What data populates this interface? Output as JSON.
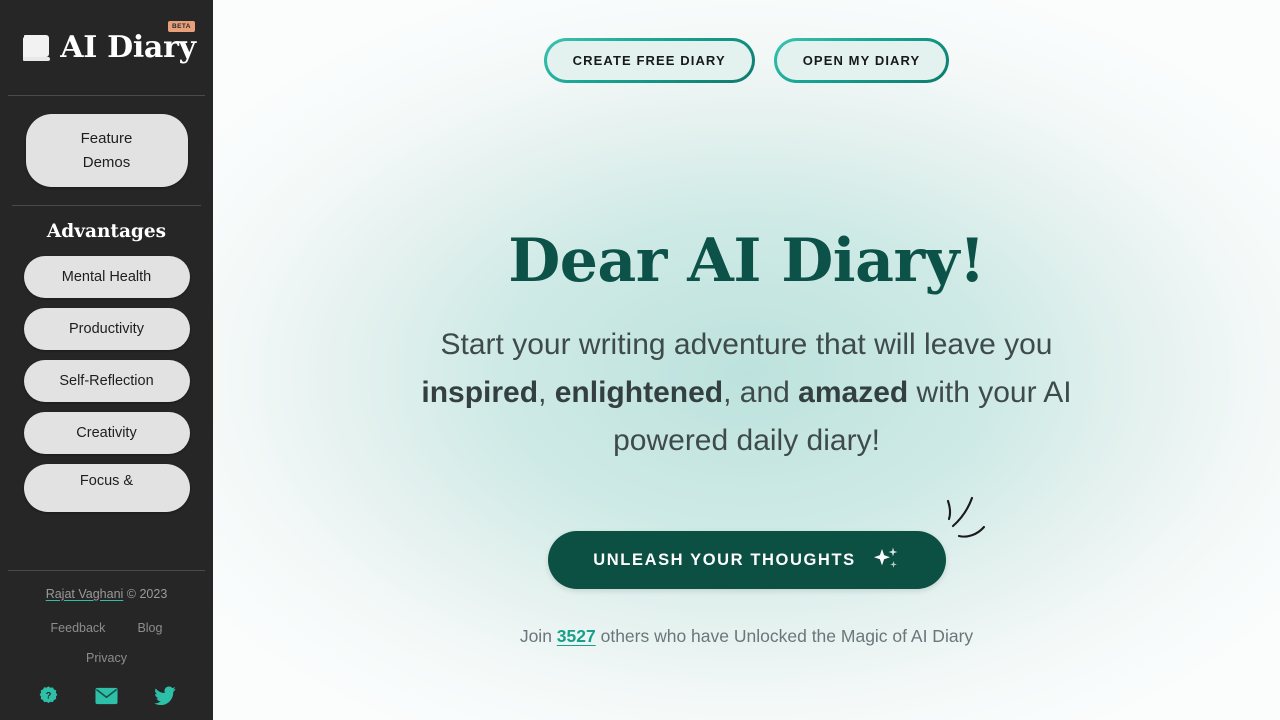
{
  "sidebar": {
    "brand": {
      "name": "AI Diary",
      "badge": "BETA",
      "icon": "book-icon"
    },
    "feature_demos_label": "Feature\nDemos",
    "feature_demos_line1": "Feature",
    "feature_demos_line2": "Demos",
    "section_title": "Advantages",
    "advantages": [
      {
        "label": "Mental Health"
      },
      {
        "label": "Productivity"
      },
      {
        "label": "Self-Reflection"
      },
      {
        "label": "Creativity"
      },
      {
        "label": "Focus &"
      }
    ],
    "footer": {
      "author": "Rajat Vaghani",
      "copyright": " © 2023",
      "links": [
        {
          "label": "Feedback"
        },
        {
          "label": "Blog"
        }
      ],
      "privacy_label": "Privacy",
      "socials": [
        {
          "name": "help-icon"
        },
        {
          "name": "email-icon"
        },
        {
          "name": "twitter-icon"
        }
      ]
    }
  },
  "main": {
    "top_buttons": {
      "create": "CREATE FREE DIARY",
      "open": "OPEN MY DIARY"
    },
    "hero_title": "Dear AI Diary!",
    "hero_sub": {
      "part1": "Start your writing adventure that will leave you ",
      "bold1": "inspired",
      "sep1": ", ",
      "bold2": "enlightened",
      "sep2": ", and ",
      "bold3": "amazed",
      "part2": " with your AI powered daily diary!"
    },
    "cta_label": "UNLEASH YOUR THOUGHTS",
    "cta_icon": "sparkle-icon",
    "join": {
      "prefix": "Join ",
      "count": "3527",
      "suffix": " others who have Unlocked the Magic of AI Diary"
    }
  },
  "colors": {
    "sidebar_bg": "#262626",
    "accent_teal": "#2dbfa8",
    "hero_green": "#0d5248",
    "cta_green": "#0c4f43",
    "badge_orange": "#e8a07a",
    "pill_gray": "#e2e2e2"
  }
}
